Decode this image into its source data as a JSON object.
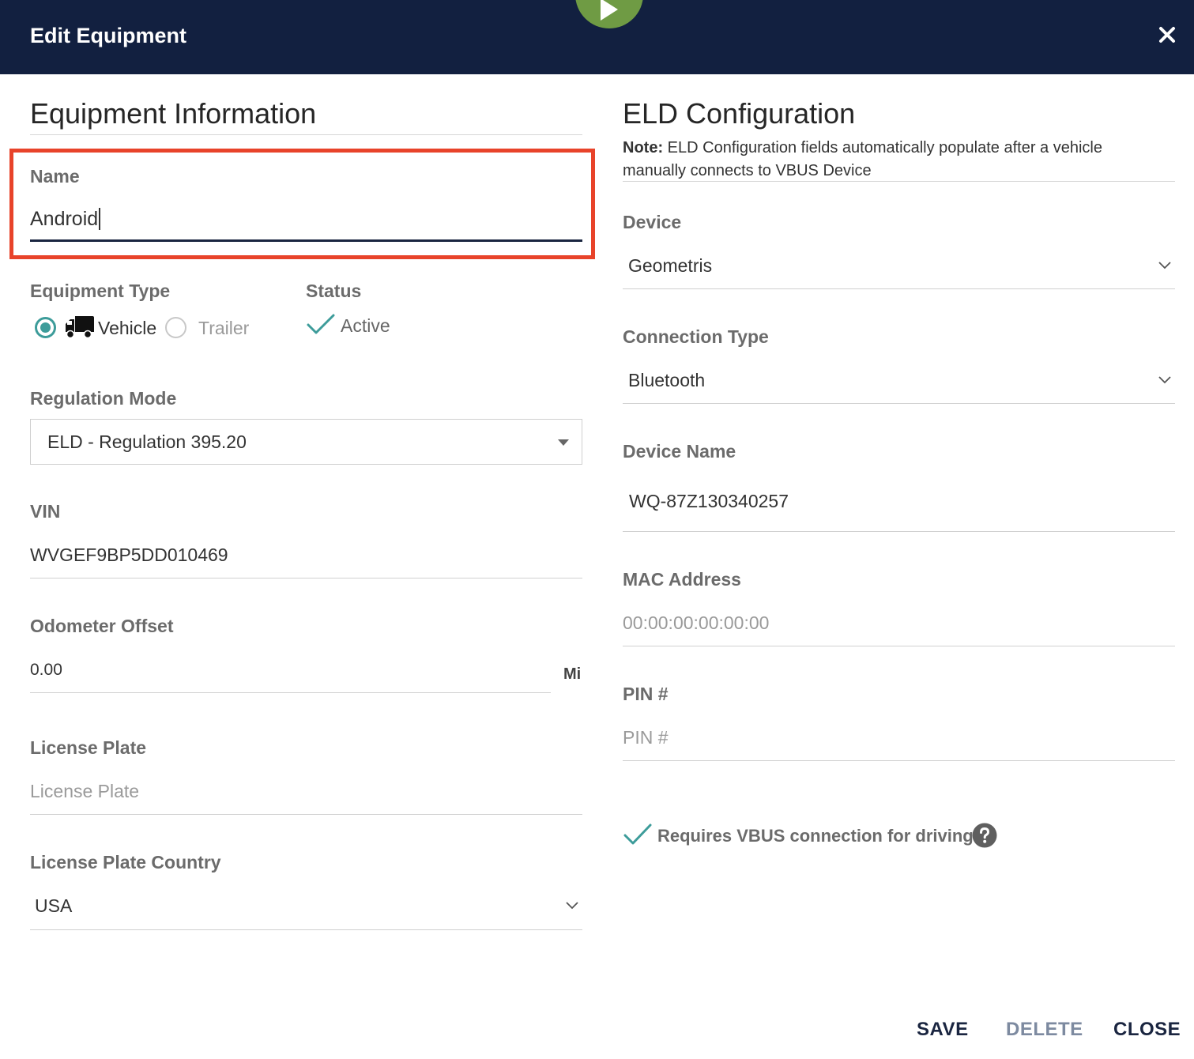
{
  "dialog": {
    "title": "Edit Equipment"
  },
  "equipment_info": {
    "title": "Equipment Information",
    "name": {
      "label": "Name",
      "value": "Android"
    },
    "equipment_type": {
      "label": "Equipment Type",
      "options": [
        {
          "label": "Vehicle",
          "selected": true
        },
        {
          "label": "Trailer",
          "selected": false
        }
      ]
    },
    "status": {
      "label": "Status",
      "value": "Active",
      "checked": true
    },
    "regulation_mode": {
      "label": "Regulation Mode",
      "value": "ELD - Regulation 395.20"
    },
    "vin": {
      "label": "VIN",
      "value": "WVGEF9BP5DD010469"
    },
    "odometer_offset": {
      "label": "Odometer Offset",
      "value": "0.00",
      "unit": "Mi"
    },
    "license_plate": {
      "label": "License Plate",
      "placeholder": "License Plate"
    },
    "license_plate_country": {
      "label": "License Plate Country",
      "value": "USA"
    }
  },
  "eld_config": {
    "title": "ELD Configuration",
    "note_label": "Note:",
    "note_text": "ELD Configuration fields automatically populate after a vehicle manually connects to VBUS Device",
    "device": {
      "label": "Device",
      "value": "Geometris"
    },
    "connection_type": {
      "label": "Connection Type",
      "value": "Bluetooth"
    },
    "device_name": {
      "label": "Device Name",
      "value": "WQ-87Z130340257"
    },
    "mac_address": {
      "label": "MAC Address",
      "placeholder": "00:00:00:00:00:00"
    },
    "pin": {
      "label": "PIN #",
      "placeholder": "PIN #"
    },
    "requires_vbus": {
      "label": "Requires VBUS connection for driving",
      "checked": true
    }
  },
  "footer": {
    "save": "SAVE",
    "delete": "DELETE",
    "close": "CLOSE"
  },
  "colors": {
    "header_bg": "#122040",
    "accent_teal": "#3d9c9a",
    "highlight_red": "#e8432a",
    "play_green": "#6f9b44",
    "save_text": "#1a2540",
    "delete_text": "#7d8aa0"
  },
  "icons": {
    "close": "close-icon",
    "play": "play-icon",
    "truck": "truck-icon",
    "check": "checkmark-icon",
    "help": "question-circle-icon",
    "dropdown": "chevron-down-icon"
  }
}
